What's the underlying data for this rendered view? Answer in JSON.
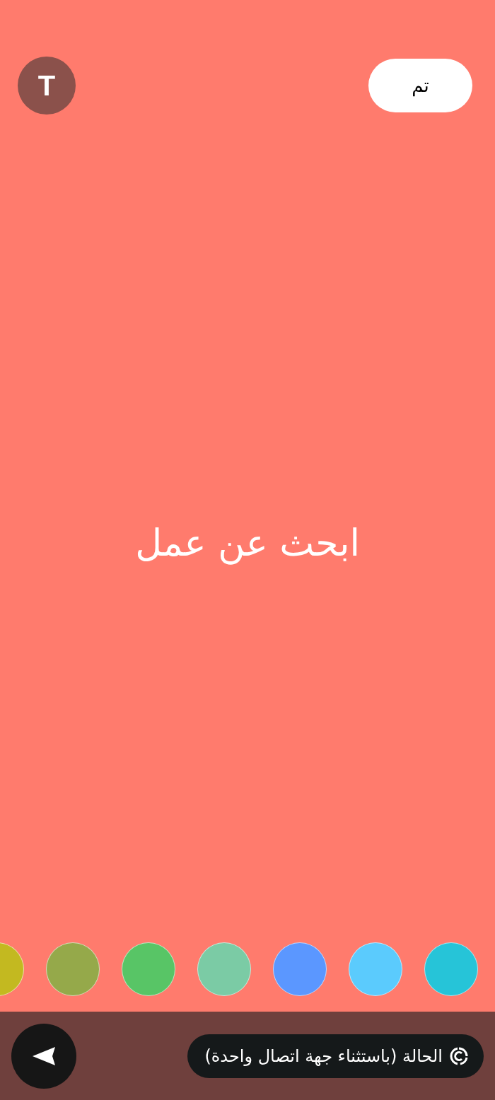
{
  "top_bar": {
    "text_style_button": "T",
    "done_button": "تم"
  },
  "status_text": "ابحث عن عمل",
  "colors": [
    {
      "color": "#26c4d8"
    },
    {
      "color": "#5bcbfd"
    },
    {
      "color": "#5b97ff"
    },
    {
      "color": "#7bcba5"
    },
    {
      "color": "#58c566"
    },
    {
      "color": "#95a94a"
    },
    {
      "color": "#c3b920"
    }
  ],
  "audience_chip": "الحالة (باستثناء جهة اتصال واحدة)"
}
